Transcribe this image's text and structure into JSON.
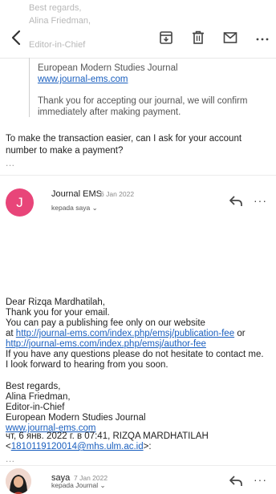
{
  "toolbar": {
    "faded_lines": [
      "Best regards,",
      "Alina Friedman,",
      "Editor-in-Chief"
    ]
  },
  "quoted": {
    "journal": "European Modern Studies Journal",
    "website": "www.journal-ems.com",
    "thanks": "Thank you for accepting our journal, we will confirm immediately after making payment."
  },
  "question": "To make the transaction easier, can I ask for your account number to make a payment?",
  "dots": "...",
  "message1": {
    "avatar_letter": "J",
    "sender": "Journal EMS",
    "date": "6 Jan 2022",
    "to": "kepada saya",
    "to_chevron": "⌄",
    "more": "···",
    "body": {
      "greeting": "Dear Rizqa Mardhatilah,",
      "line1": "Thank you for your email.",
      "line2": "You can pay a publishing fee only on our website",
      "at": "at",
      "link1": "http://journal-ems.com/index.php/emsj/publication-fee",
      "or": "or",
      "link2": "http://journal-ems.com/index.php/emsj/author-fee",
      "line3": "If you have any questions please do not hesitate to contact me.",
      "line4": "I look forward to hearing from you soon."
    },
    "signature": {
      "closing": "Best regards,",
      "name": "Alina Friedman,",
      "title": "Editor-in-Chief",
      "journal": "European Modern Studies Journal",
      "website": "www.journal-ems.com"
    },
    "quote_header_1": "чт, 6 янв. 2022 г. в 07:41, RIZQA MARDHATILAH",
    "quote_header_email": "1810119120014@mhs.ulm.ac.id",
    "quote_header_lt": "<",
    "quote_header_gt": ">:"
  },
  "message2": {
    "sender": "saya",
    "date": "7 Jan 2022",
    "to": "kepada Journal",
    "to_chevron": "⌄",
    "more": "···"
  }
}
